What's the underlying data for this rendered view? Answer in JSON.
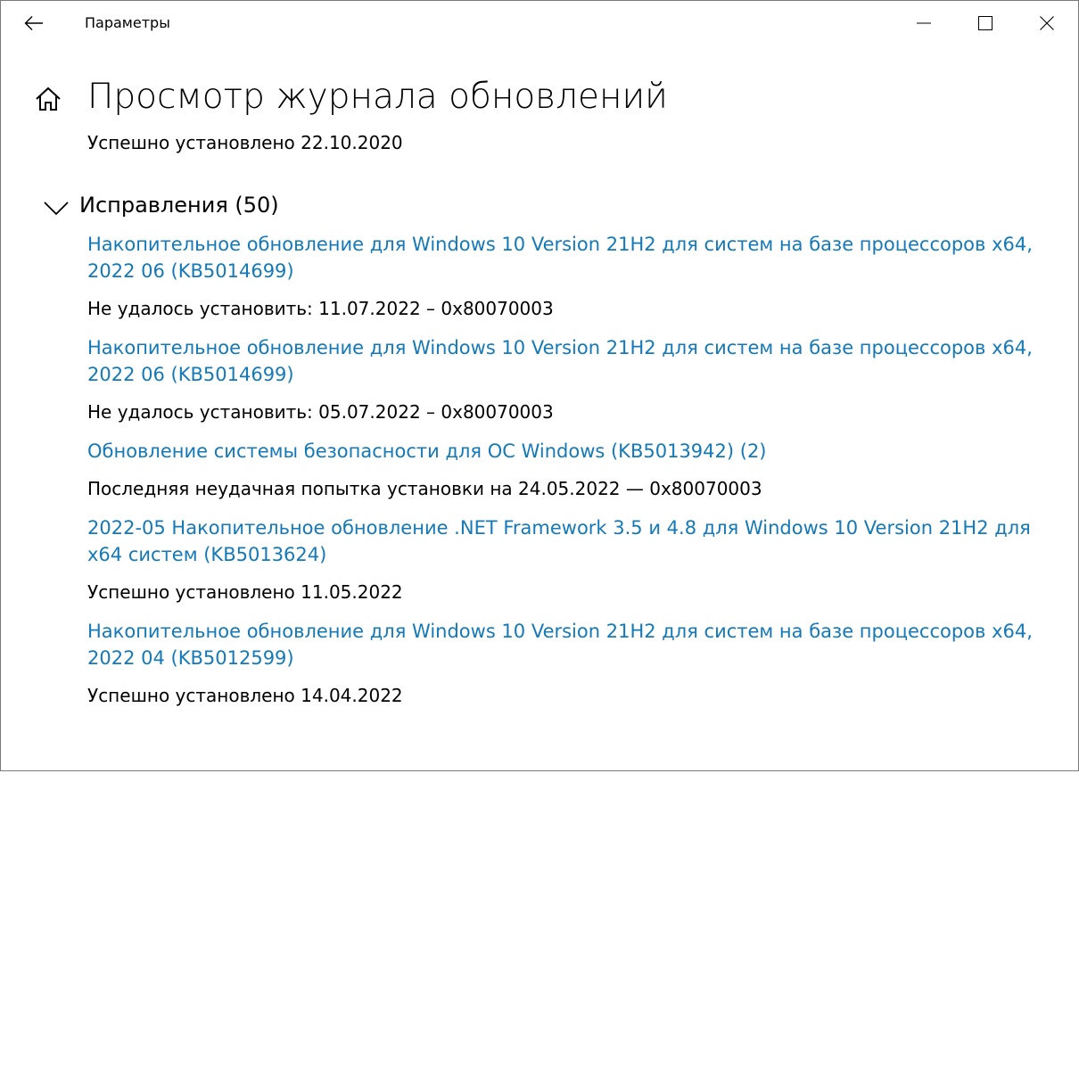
{
  "window": {
    "title": "Параметры"
  },
  "page": {
    "title": "Просмотр журнала обновлений",
    "previous_status": "Успешно установлено 22.10.2020"
  },
  "section": {
    "title": "Исправления (50)",
    "expanded": true
  },
  "updates": [
    {
      "name": "Накопительное обновление для Windows 10 Version 21H2 для систем на базе процессоров x64, 2022 06 (KB5014699)",
      "status": "Не удалось установить: 11.07.2022 – 0x80070003"
    },
    {
      "name": "Накопительное обновление для Windows 10 Version 21H2 для систем на базе процессоров x64, 2022 06 (KB5014699)",
      "status": "Не удалось установить: 05.07.2022 – 0x80070003"
    },
    {
      "name": "Обновление системы безопасности для ОС Windows (KB5013942) (2)",
      "status": "Последняя неудачная попытка установки на 24.05.2022 — 0x80070003"
    },
    {
      "name": "2022-05 Накопительное обновление .NET Framework 3.5 и 4.8 для Windows 10 Version 21H2 для x64 систем (KB5013624)",
      "status": "Успешно установлено 11.05.2022"
    },
    {
      "name": "Накопительное обновление для Windows 10 Version 21H2 для систем на базе процессоров x64, 2022 04 (KB5012599)",
      "status": "Успешно установлено 14.04.2022"
    }
  ],
  "icons": {
    "back": "back-arrow-icon",
    "minimize": "minimize-icon",
    "maximize": "maximize-icon",
    "close": "close-icon",
    "home": "home-icon",
    "expand": "chevron-down-icon"
  },
  "colors": {
    "link": "#1479b8",
    "text": "#000000",
    "background": "#ffffff"
  }
}
